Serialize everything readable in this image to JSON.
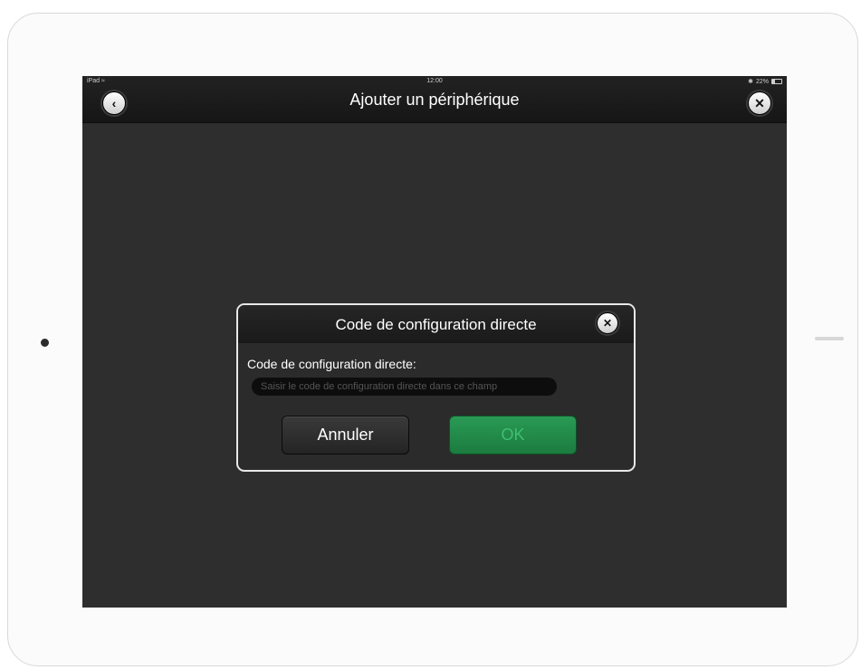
{
  "statusbar": {
    "device": "iPad",
    "wifi_icon": "wifi-icon",
    "time": "12:00",
    "bluetooth": "✱",
    "battery_percent": "22%"
  },
  "navbar": {
    "title": "Ajouter un périphérique",
    "back_icon": "chevron-left-icon",
    "close_icon": "close-icon"
  },
  "dialog": {
    "title": "Code de configuration directe",
    "close_icon": "close-icon",
    "field_label": "Code de configuration directe:",
    "input_placeholder": "Saisir le code de configuration directe dans ce champ",
    "input_value": "",
    "cancel_label": "Annuler",
    "ok_label": "OK"
  },
  "colors": {
    "screen_background": "#2e2e2e",
    "ok_button": "#1f8a47",
    "dialog_border": "#e8e8e8"
  }
}
